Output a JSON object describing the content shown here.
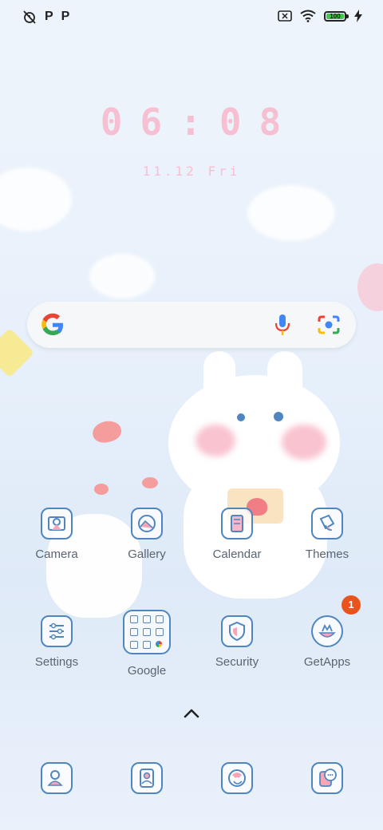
{
  "status_bar": {
    "left_icons": [
      "alarm-off-icon",
      "p-notification-icon",
      "p-notification-icon"
    ],
    "left_glyphs": [
      "P",
      "P"
    ],
    "right_icons": [
      "sim-off-icon",
      "wifi-icon",
      "battery-icon",
      "charging-icon"
    ],
    "battery_level": "100"
  },
  "clock": {
    "time": "06:08",
    "date": "11.12 Fri"
  },
  "search": {
    "icons": [
      "google-logo",
      "voice-search-icon",
      "lens-icon"
    ]
  },
  "apps": [
    {
      "label": "Camera",
      "icon": "camera-icon"
    },
    {
      "label": "Gallery",
      "icon": "gallery-icon"
    },
    {
      "label": "Calendar",
      "icon": "calendar-icon"
    },
    {
      "label": "Themes",
      "icon": "themes-icon"
    },
    {
      "label": "Settings",
      "icon": "settings-icon"
    },
    {
      "label": "Google",
      "icon": "google-folder-icon"
    },
    {
      "label": "Security",
      "icon": "security-icon"
    },
    {
      "label": "GetApps",
      "icon": "getapps-icon",
      "badge": "1"
    }
  ],
  "dock": [
    {
      "icon": "phone-icon"
    },
    {
      "icon": "contacts-icon"
    },
    {
      "icon": "browser-icon"
    },
    {
      "icon": "messaging-icon"
    }
  ],
  "colors": {
    "clock": "#f6bfd2",
    "icon_stroke": "#4f86c0",
    "label": "#5a6472",
    "badge": "#e9541c"
  }
}
